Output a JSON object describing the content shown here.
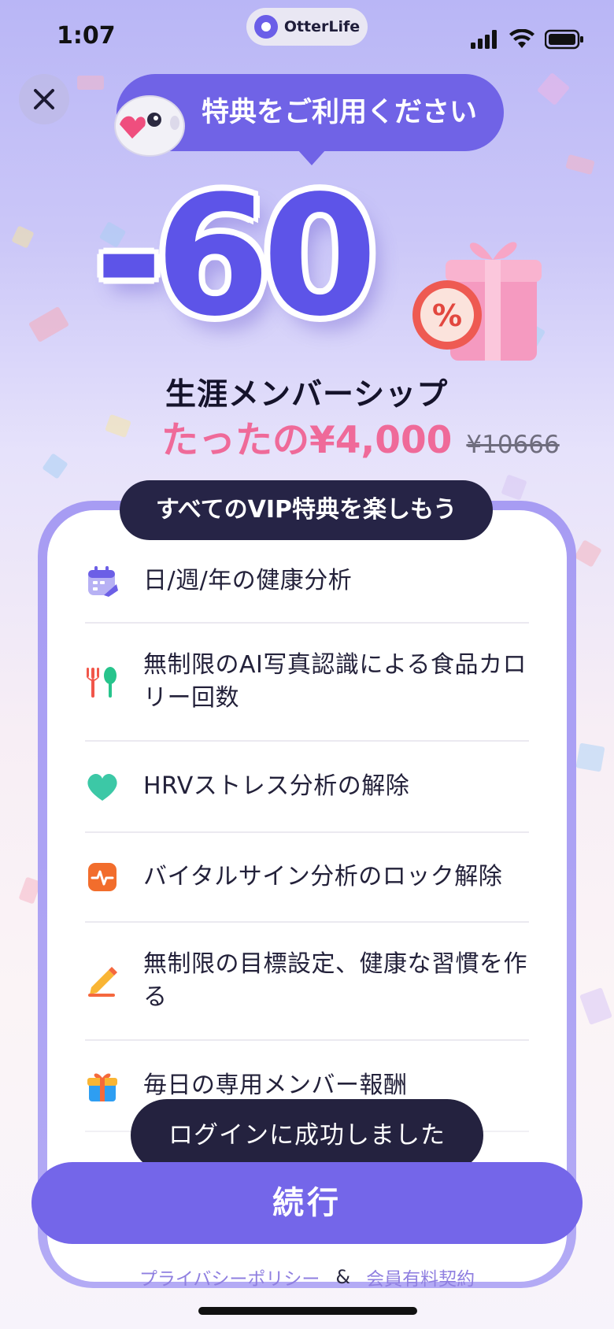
{
  "status_bar": {
    "time": "1:07",
    "app_name": "OtterLife"
  },
  "close_icon": "close-icon",
  "promo": {
    "bubble_text": "特典をご利用ください",
    "discount": "-60",
    "badge_symbol": "%"
  },
  "offer": {
    "title": "生涯メンバーシップ",
    "price": "たったの¥4,000",
    "original_price": "¥10666"
  },
  "features": {
    "header": "すべてのVIP特典を楽しもう",
    "items": [
      {
        "label": "日/週/年の健康分析",
        "icon": "calendar-icon"
      },
      {
        "label": "無制限のAI写真認識による食品カロリー回数",
        "icon": "fork-spoon-icon"
      },
      {
        "label": "HRVストレス分析の解除",
        "icon": "heart-icon"
      },
      {
        "label": "バイタルサイン分析のロック解除",
        "icon": "pulse-icon"
      },
      {
        "label": "無制限の目標設定、健康な習慣を作る",
        "icon": "pencil-icon"
      },
      {
        "label": "毎日の専用メンバー報酬",
        "icon": "gift-icon"
      }
    ]
  },
  "toast": "ログインに成功しました",
  "continue_button": "続行",
  "footer": {
    "privacy_policy": "プライバシーポリシー",
    "separator": "&",
    "membership_terms": "会員有料契約"
  },
  "colors": {
    "accent": "#7466e9",
    "price": "#ef6a99",
    "dark": "#24223f"
  }
}
